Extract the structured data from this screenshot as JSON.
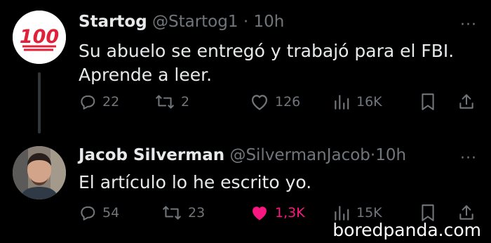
{
  "tweets": [
    {
      "name": "Startog",
      "handle": "@Startog1",
      "separator": "·",
      "time": "10h",
      "text_line1": "Su abuelo se entregó y trabajó para el FBI.",
      "text_line2": "Aprende a leer.",
      "avatar_icon": "hundred-points-emoji",
      "avatar_text": "100",
      "more": "···",
      "replies": "22",
      "retweets": "2",
      "likes": "126",
      "views": "16K",
      "liked": false
    },
    {
      "name": "Jacob Silverman",
      "handle": "@SilvermanJacob",
      "separator": "·",
      "time": "10h",
      "text_line1": "El artículo lo he escrito yo.",
      "avatar_icon": "profile-photo",
      "more": "···",
      "replies": "54",
      "retweets": "23",
      "likes": "1,3K",
      "views": "15K",
      "liked": true
    }
  ],
  "watermark": "boredpanda.com",
  "colors": {
    "background": "#000000",
    "muted": "#71767b",
    "text": "#e7e9ea",
    "like_active": "#f91880",
    "emoji_red": "#e0213a"
  }
}
